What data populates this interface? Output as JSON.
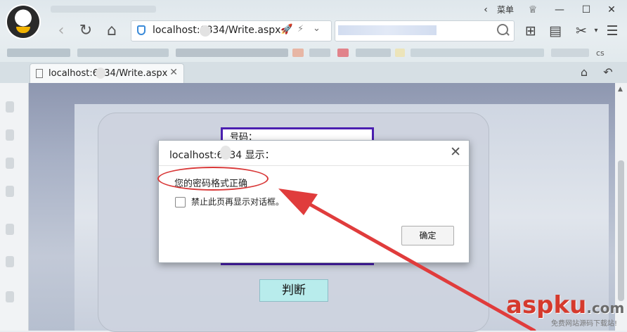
{
  "browser": {
    "menu_label": "菜单",
    "address": "localhost:6834/Write.aspx",
    "tab_title": "localhost:6834/Write.aspx",
    "bookmark_suffix": "cs"
  },
  "page": {
    "password_label": "号码：",
    "judge_button": "判断"
  },
  "dialog": {
    "title": "localhost:6834 显示：",
    "message": "您的密码格式正确",
    "suppress_label": "禁止此页再显示对话框。",
    "ok_button": "确定"
  },
  "watermark": {
    "logo": "aspku",
    "logo_suffix": ".com",
    "subtitle": "免费网站源码下载站!"
  },
  "colors": {
    "accent": "#d93838",
    "page_border": "#4b1fb0",
    "judge_button_bg": "#b8ecec"
  }
}
